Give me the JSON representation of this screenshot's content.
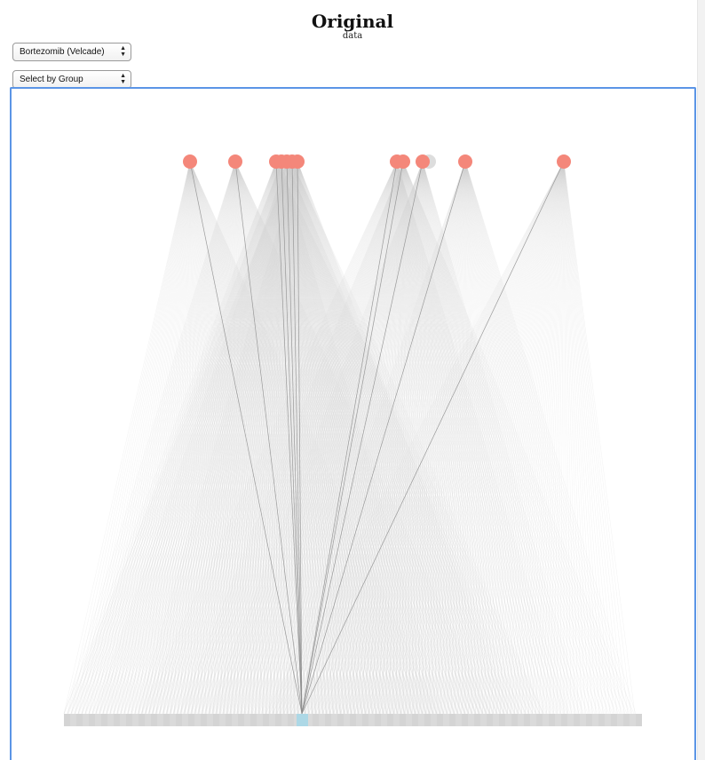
{
  "header": {
    "title": "Original",
    "subtitle": "data"
  },
  "controls": {
    "drug_select": {
      "selected": "Bortezomib (Velcade)"
    },
    "group_select": {
      "selected": "Select by Group"
    }
  },
  "graph": {
    "top_node_color": "#f4877a",
    "dimmed_node_color": "#dddddd",
    "bottom_bar_color": "#d9d9d9",
    "highlight_node_color": "#add8e6",
    "edge_color": "#9a9a9a",
    "highlight_edge_color": "#8c8c8c",
    "frame_color": "#5b95e6"
  }
}
